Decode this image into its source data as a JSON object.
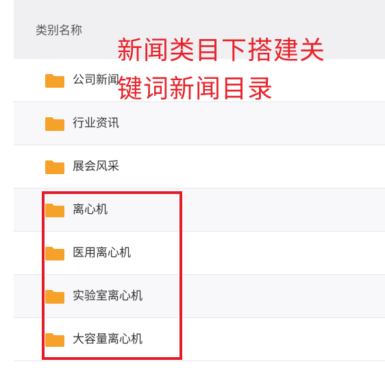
{
  "header": {
    "column_label": "类别名称"
  },
  "categories": [
    {
      "label": "公司新闻"
    },
    {
      "label": "行业资讯"
    },
    {
      "label": "展会风采"
    },
    {
      "label": "离心机"
    },
    {
      "label": "医用离心机"
    },
    {
      "label": "实验室离心机"
    },
    {
      "label": "大容量离心机"
    }
  ],
  "annotation": {
    "line1": "新闻类目下搭建关",
    "line2": "键词新闻目录",
    "color": "#e8232b"
  },
  "highlight_color": "#e31c2a",
  "icons": {
    "row_icon": "folder-icon",
    "folder_color": "#f5a12a"
  }
}
